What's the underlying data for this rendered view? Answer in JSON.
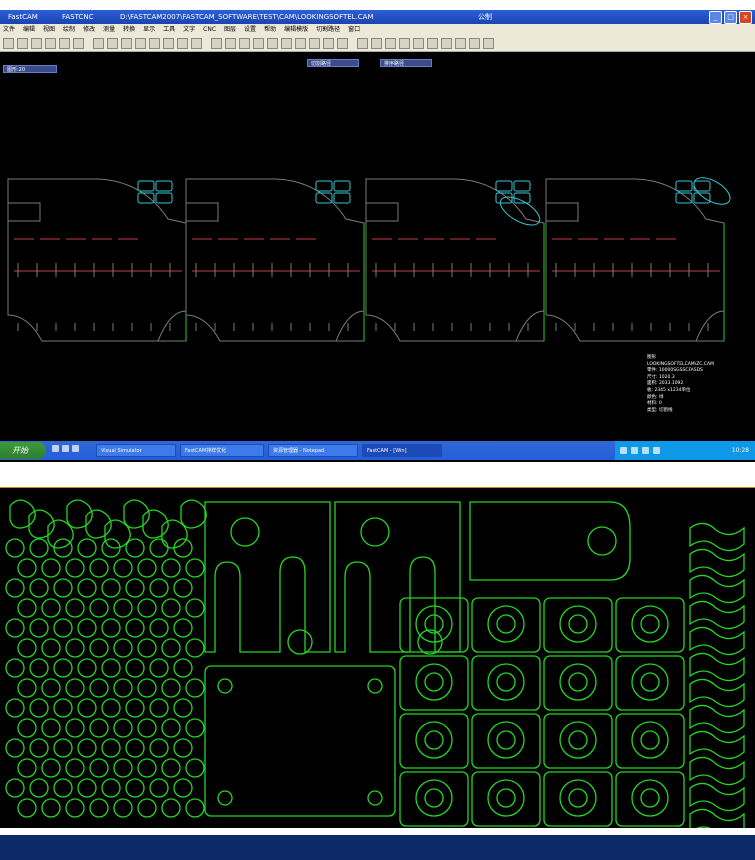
{
  "window": {
    "title_app": "FastCAM",
    "title_sub": "FASTCNC",
    "title_path": "D:\\FASTCAM2007\\FASTCAM_SOFTWARE\\TEST\\CAM\\LOOKINGSOFTEL.CAM",
    "title_extra": "公制",
    "min": "_",
    "max": "□",
    "close": "×"
  },
  "menu": {
    "items": [
      "文件",
      "编辑",
      "视图",
      "绘制",
      "修改",
      "测量",
      "转换",
      "显示",
      "工具",
      "文字",
      "CNC",
      "图层",
      "设置",
      "帮助",
      "编辑模版",
      "切割路径",
      "窗口"
    ]
  },
  "status_chip": "图形:20",
  "canvas_tabs": [
    "切割路径",
    "排序路径"
  ],
  "info_panel": {
    "lines": [
      "图形",
      "LOOKINGSOFTELCAM\\ZC.CAM",
      "零件: 10000SGSSCFASDS",
      "尺寸: 1020.3",
      "面积: 2033.1092",
      "板: 2345 x1234单位",
      "颜色: 绿",
      "材料: 0",
      "类型: 切割线"
    ]
  },
  "taskbar": {
    "start": "开始",
    "tasks": [
      "Visual Simulator",
      "FastCAM排样优化",
      "资源管理器 - Notepad",
      "FastCAM - [Win]"
    ],
    "clock": "10:28"
  },
  "colors": {
    "outline": "#7a7a7a",
    "cut_green": "#1fd21f",
    "path_red": "#c83a4a",
    "bridge_cyan": "#36c8d2",
    "nest_green": "#23d823",
    "bottom_band": "#0b2a66"
  }
}
